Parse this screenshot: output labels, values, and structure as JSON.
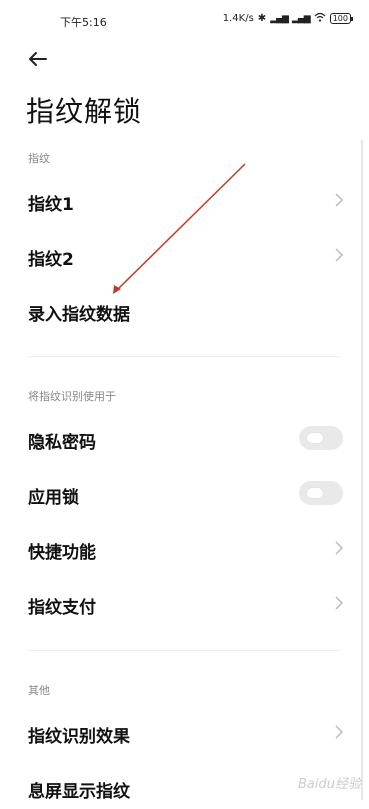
{
  "status_bar": {
    "time": "下午5:16",
    "net_speed": "1.4K/s",
    "battery": "100",
    "icons": [
      "bluetooth-icon",
      "signal-icon",
      "signal-icon",
      "wifi-icon",
      "battery-icon"
    ]
  },
  "title": "指纹解锁",
  "sections": [
    {
      "label": "指纹",
      "items": [
        {
          "label": "指纹1",
          "control": "chevron"
        },
        {
          "label": "指纹2",
          "control": "chevron"
        },
        {
          "label": "录入指纹数据",
          "control": "none"
        }
      ]
    },
    {
      "label": "将指纹识别使用于",
      "items": [
        {
          "label": "隐私密码",
          "control": "toggle",
          "on": false
        },
        {
          "label": "应用锁",
          "control": "toggle",
          "on": false
        },
        {
          "label": "快捷功能",
          "control": "chevron"
        },
        {
          "label": "指纹支付",
          "control": "chevron"
        }
      ]
    },
    {
      "label": "其他",
      "items": [
        {
          "label": "指纹识别效果",
          "control": "chevron"
        },
        {
          "label": "息屏显示指纹",
          "control": "none"
        }
      ]
    }
  ],
  "watermark": "Baidu经验",
  "colors": {
    "annotation_arrow": "#c0392b",
    "toggle_off": "#e9e9e9"
  }
}
